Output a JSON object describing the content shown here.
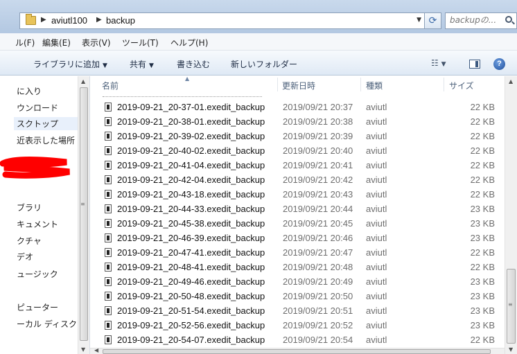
{
  "address": {
    "crumbs": [
      "aviutl100",
      "backup"
    ],
    "search_placeholder": "backupの..."
  },
  "menu": [
    "ル(F)",
    "編集(E)",
    "表示(V)",
    "ツール(T)",
    "ヘルプ(H)"
  ],
  "commands": {
    "library": "ライブラリに追加",
    "share": "共有",
    "burn": "書き込む",
    "new_folder": "新しいフォルダー"
  },
  "nav": {
    "items": [
      "に入り",
      "ウンロード",
      "スクトップ",
      "近表示した場所",
      "ブラリ",
      "キュメント",
      "クチャ",
      "デオ",
      "ュージック",
      "ピューター",
      "ーカル ディスク"
    ]
  },
  "columns": {
    "name": "名前",
    "date": "更新日時",
    "type": "種類",
    "size": "サイズ"
  },
  "files": [
    {
      "name": "2019-09-21_20-37-01.exedit_backup",
      "date": "2019/09/21 20:37",
      "type": "aviutl",
      "size": "22 KB"
    },
    {
      "name": "2019-09-21_20-38-01.exedit_backup",
      "date": "2019/09/21 20:38",
      "type": "aviutl",
      "size": "22 KB"
    },
    {
      "name": "2019-09-21_20-39-02.exedit_backup",
      "date": "2019/09/21 20:39",
      "type": "aviutl",
      "size": "22 KB"
    },
    {
      "name": "2019-09-21_20-40-02.exedit_backup",
      "date": "2019/09/21 20:40",
      "type": "aviutl",
      "size": "22 KB"
    },
    {
      "name": "2019-09-21_20-41-04.exedit_backup",
      "date": "2019/09/21 20:41",
      "type": "aviutl",
      "size": "22 KB"
    },
    {
      "name": "2019-09-21_20-42-04.exedit_backup",
      "date": "2019/09/21 20:42",
      "type": "aviutl",
      "size": "22 KB"
    },
    {
      "name": "2019-09-21_20-43-18.exedit_backup",
      "date": "2019/09/21 20:43",
      "type": "aviutl",
      "size": "22 KB"
    },
    {
      "name": "2019-09-21_20-44-33.exedit_backup",
      "date": "2019/09/21 20:44",
      "type": "aviutl",
      "size": "23 KB"
    },
    {
      "name": "2019-09-21_20-45-38.exedit_backup",
      "date": "2019/09/21 20:45",
      "type": "aviutl",
      "size": "23 KB"
    },
    {
      "name": "2019-09-21_20-46-39.exedit_backup",
      "date": "2019/09/21 20:46",
      "type": "aviutl",
      "size": "23 KB"
    },
    {
      "name": "2019-09-21_20-47-41.exedit_backup",
      "date": "2019/09/21 20:47",
      "type": "aviutl",
      "size": "22 KB"
    },
    {
      "name": "2019-09-21_20-48-41.exedit_backup",
      "date": "2019/09/21 20:48",
      "type": "aviutl",
      "size": "22 KB"
    },
    {
      "name": "2019-09-21_20-49-46.exedit_backup",
      "date": "2019/09/21 20:49",
      "type": "aviutl",
      "size": "23 KB"
    },
    {
      "name": "2019-09-21_20-50-48.exedit_backup",
      "date": "2019/09/21 20:50",
      "type": "aviutl",
      "size": "23 KB"
    },
    {
      "name": "2019-09-21_20-51-54.exedit_backup",
      "date": "2019/09/21 20:51",
      "type": "aviutl",
      "size": "23 KB"
    },
    {
      "name": "2019-09-21_20-52-56.exedit_backup",
      "date": "2019/09/21 20:52",
      "type": "aviutl",
      "size": "23 KB"
    },
    {
      "name": "2019-09-21_20-54-07.exedit_backup",
      "date": "2019/09/21 20:54",
      "type": "aviutl",
      "size": "22 KB"
    }
  ],
  "icons": [
    "folder-icon",
    "refresh-icon",
    "search-icon",
    "views-icon",
    "preview-pane-icon",
    "help-icon",
    "file-icon"
  ],
  "colors": {
    "frame": "#b3c8e2",
    "redaction": "#ff0000",
    "header_text": "#4c607a",
    "meta_text": "#6d6d6d"
  }
}
